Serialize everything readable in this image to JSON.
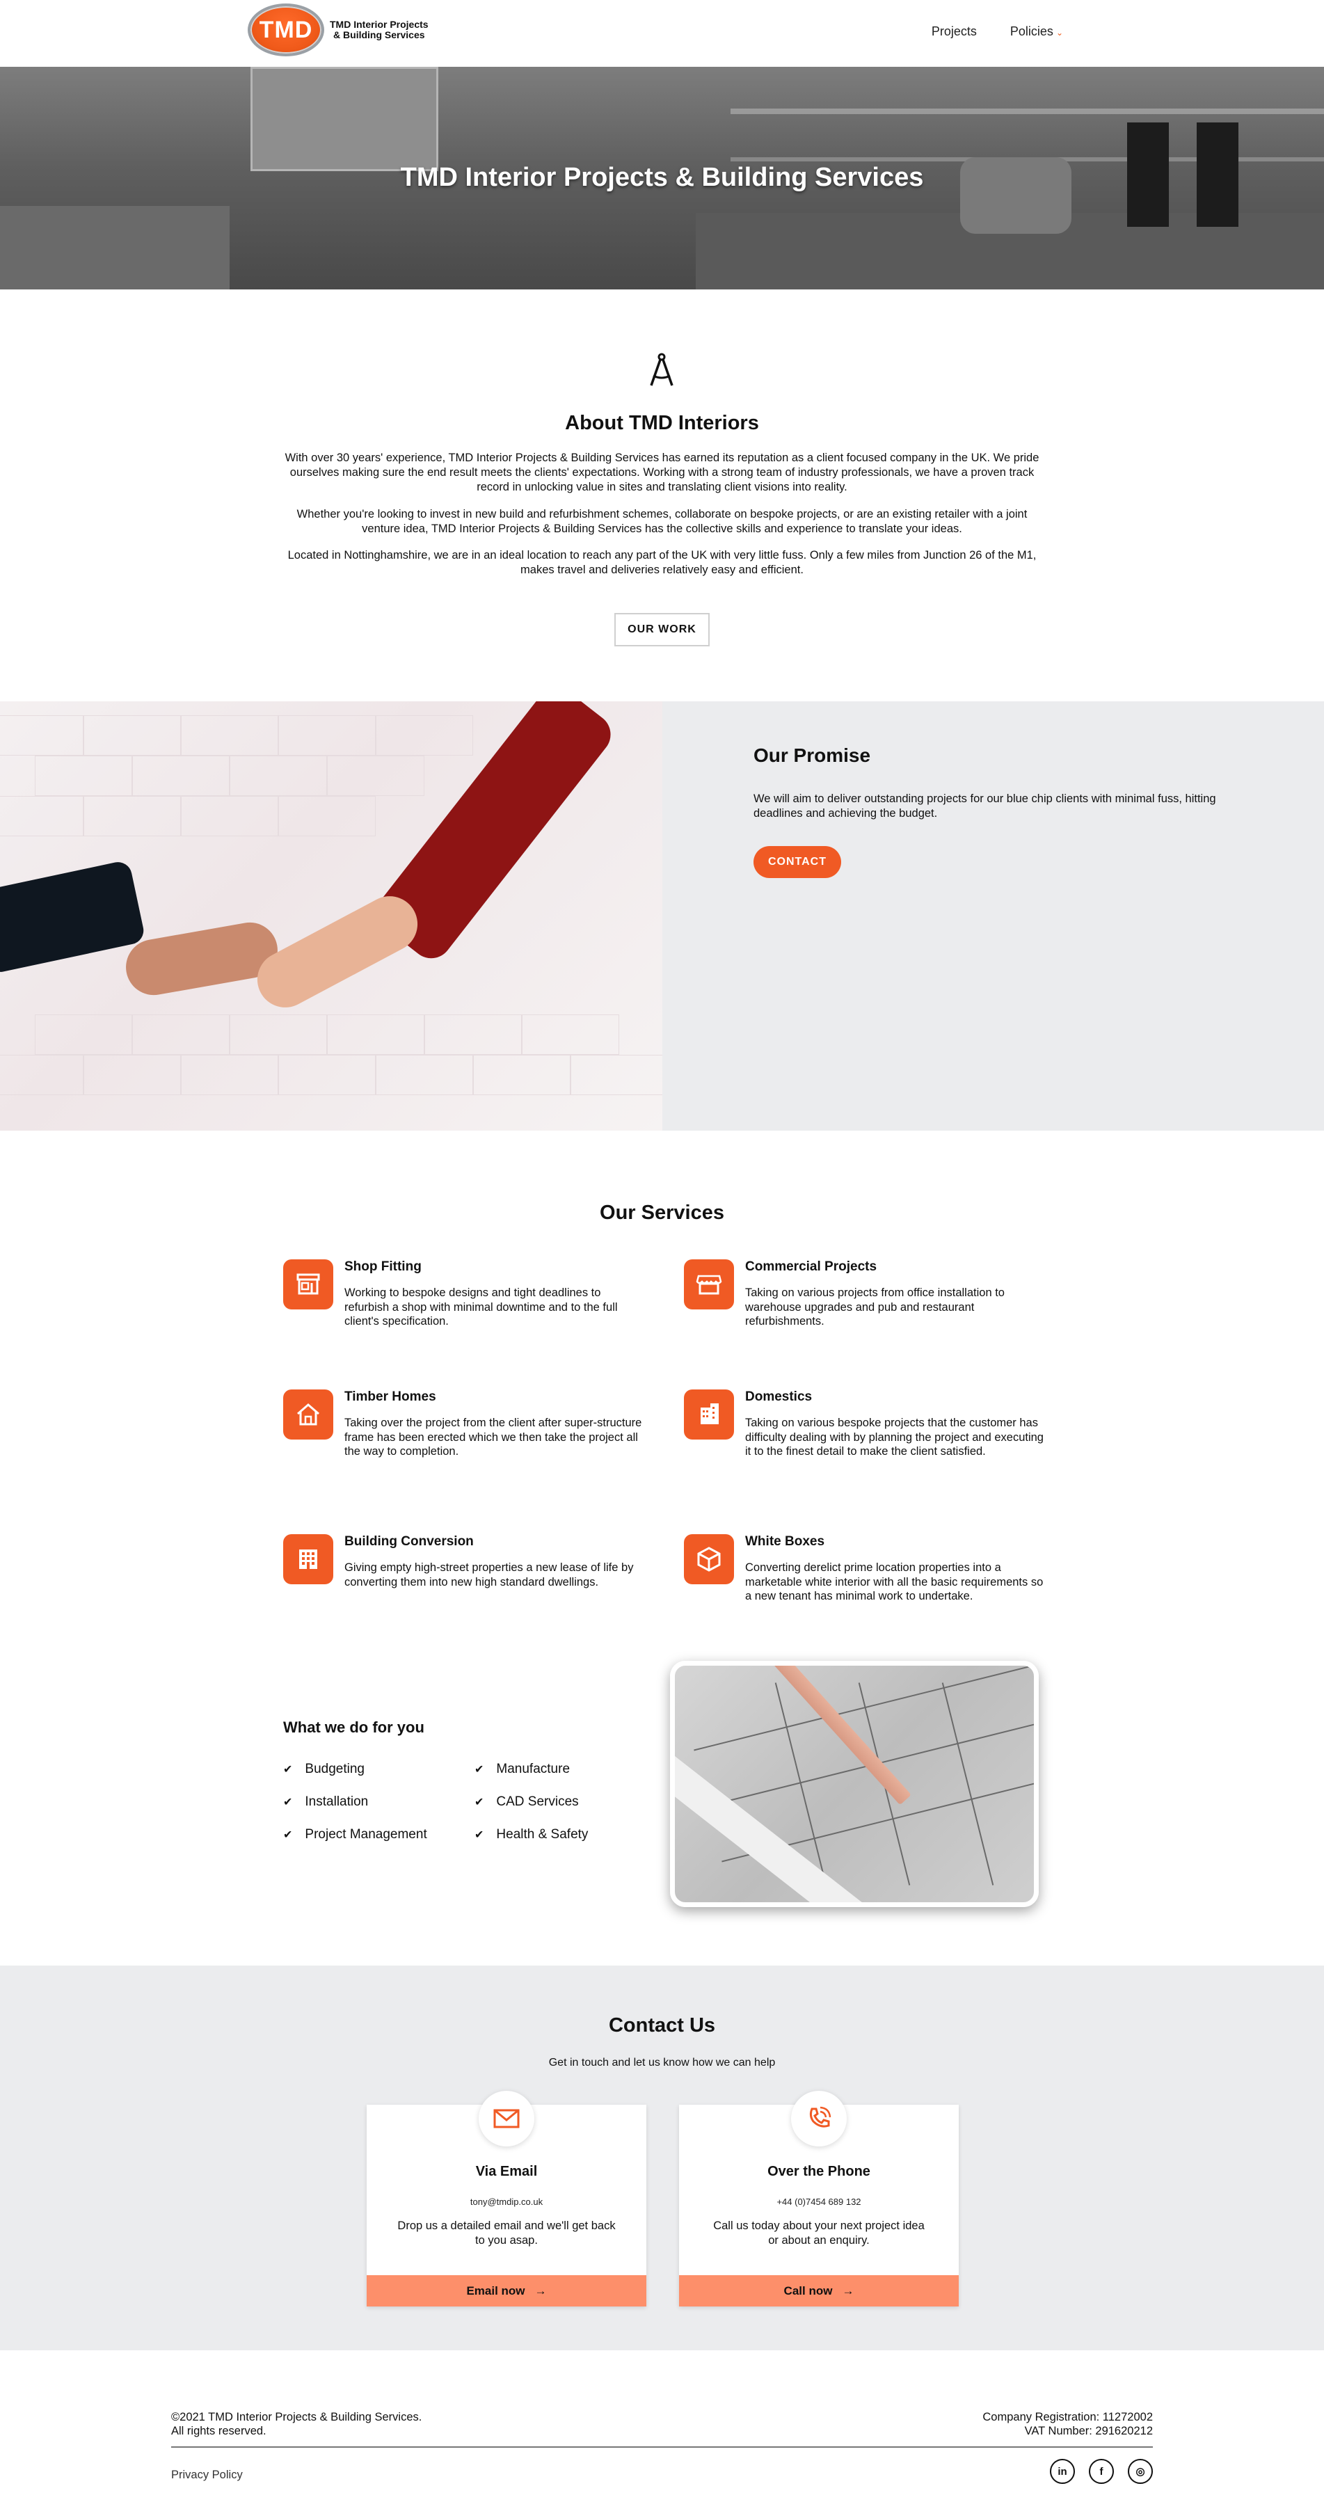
{
  "header": {
    "logo_mark": "TMD",
    "logo_line1": "TMD Interior Projects",
    "logo_line2": "& Building Services",
    "nav": [
      {
        "label": "Projects"
      },
      {
        "label": "Policies"
      }
    ]
  },
  "hero": {
    "title": "TMD Interior Projects & Building Services"
  },
  "about": {
    "title": "About TMD Interiors",
    "paragraphs": [
      "With over 30 years' experience, TMD Interior Projects & Building Services has earned its reputation as a client focused company in the UK. We pride ourselves making sure the end result meets the clients' expectations. Working with a strong team of industry professionals, we have a proven track record in unlocking value in sites and translating client visions into reality.",
      "Whether you're looking to invest in new build and refurbishment schemes, collaborate on bespoke projects, or are an existing retailer with a joint venture idea, TMD Interior Projects & Building Services has the collective skills and experience to translate your ideas.",
      "Located in Nottinghamshire, we are in an ideal location to reach any part of the UK with very little fuss. Only a few miles from Junction 26 of the M1, makes travel and deliveries relatively easy and efficient."
    ],
    "button": "OUR WORK"
  },
  "promise": {
    "title": "Our Promise",
    "text": "We will aim to deliver outstanding projects for our blue chip clients with minimal fuss, hitting deadlines and achieving the budget.",
    "button": "CONTACT"
  },
  "services": {
    "title": "Our Services",
    "items": [
      {
        "title": "Shop Fitting",
        "desc": "Working to bespoke designs and tight deadlines to refurbish a shop with minimal downtime and to the full client's specification.",
        "icon": "shop-fitting-icon"
      },
      {
        "title": "Commercial Projects",
        "desc": "Taking on various projects from office installation to warehouse upgrades and pub and restaurant refurbishments.",
        "icon": "storefront-icon"
      },
      {
        "title": "Timber Homes",
        "desc": "Taking over the project from the client after super-structure frame has been erected which we then take the project all the way to completion.",
        "icon": "house-icon"
      },
      {
        "title": "Domestics",
        "desc": "Taking on various bespoke projects that the customer has difficulty dealing with by planning the project and executing it to the finest detail to make the client satisfied.",
        "icon": "apartment-icon"
      },
      {
        "title": "Building Conversion",
        "desc": "Giving empty high-street properties a new lease of life by converting them into new high standard dwellings.",
        "icon": "building-icon"
      },
      {
        "title": "White Boxes",
        "desc": "Converting derelict prime location properties into a marketable white interior with all the basic requirements so a new tenant has minimal work to undertake.",
        "icon": "box-icon"
      }
    ]
  },
  "whatwedo": {
    "title": "What we do for you",
    "items": [
      "Budgeting",
      "Manufacture",
      "Installation",
      "CAD Services",
      "Project Management",
      "Health & Safety"
    ]
  },
  "contact": {
    "title": "Contact Us",
    "subtitle": "Get in touch and let us know how we can help",
    "cards": [
      {
        "title": "Via Email",
        "meta": "tony@tmdip.co.uk",
        "desc": "Drop us a detailed email and we'll get back to you asap.",
        "button": "Email now",
        "icon": "envelope-icon"
      },
      {
        "title": "Over the Phone",
        "meta": "+44 (0)7454 689 132",
        "desc": "Call us today about your next project idea or about an enquiry.",
        "button": "Call now",
        "icon": "phone-icon"
      }
    ]
  },
  "footer": {
    "copyright_line1": "©2021 TMD Interior Projects & Building Services.",
    "copyright_line2": "All rights reserved.",
    "company_reg": "Company Registration: 11272002",
    "vat": "VAT Number: 291620212",
    "privacy": "Privacy Policy",
    "social": [
      "in",
      "f",
      "◎"
    ]
  },
  "colors": {
    "accent": "#f05a24",
    "button_soft": "#fd8f6a",
    "panel_bg": "#ebecee"
  }
}
